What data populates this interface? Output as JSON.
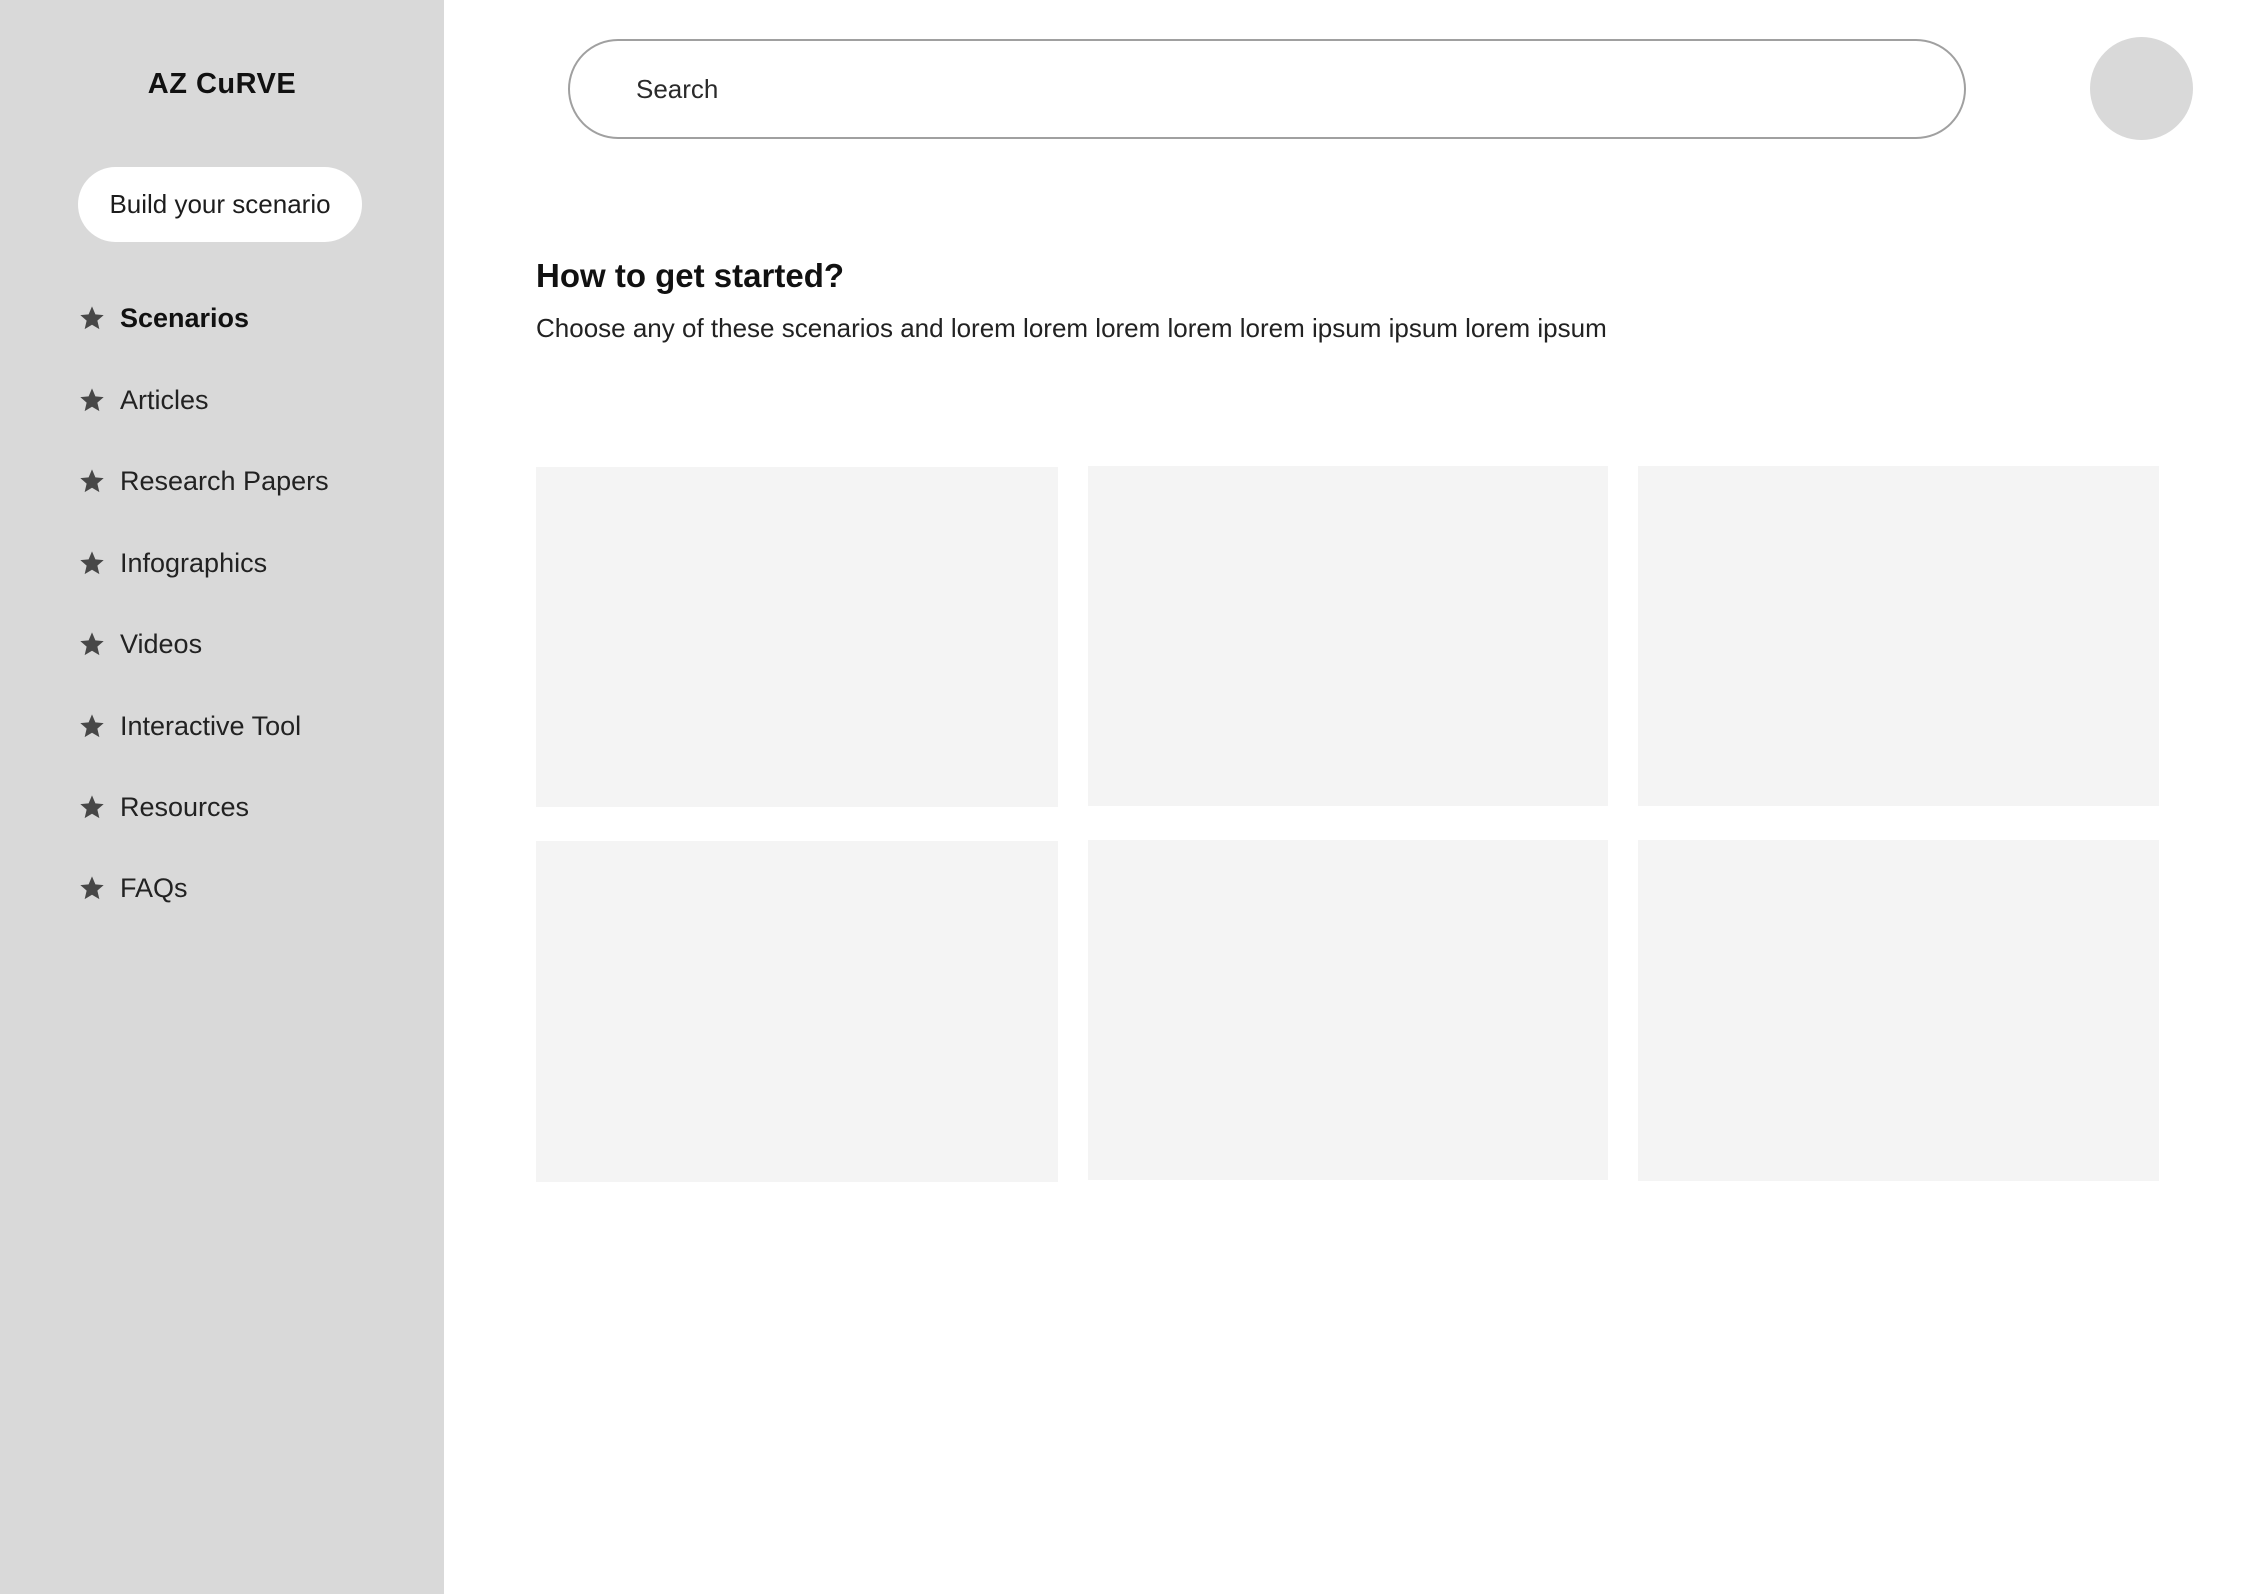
{
  "sidebar": {
    "logo": "AZ CuRVE",
    "build_button": "Build your scenario",
    "items": [
      {
        "label": "Scenarios",
        "icon": "star-icon",
        "active": true
      },
      {
        "label": "Articles",
        "icon": "star-icon",
        "active": false
      },
      {
        "label": "Research Papers",
        "icon": "star-icon",
        "active": false
      },
      {
        "label": "Infographics",
        "icon": "star-icon",
        "active": false
      },
      {
        "label": "Videos",
        "icon": "star-icon",
        "active": false
      },
      {
        "label": "Interactive Tool",
        "icon": "star-icon",
        "active": false
      },
      {
        "label": "Resources",
        "icon": "star-icon",
        "active": false
      },
      {
        "label": "FAQs",
        "icon": "star-icon",
        "active": false
      }
    ]
  },
  "header": {
    "search": {
      "placeholder": "Search",
      "value": ""
    },
    "avatar": "user-avatar"
  },
  "main": {
    "heading": "How to get started?",
    "subtitle": "Choose any of these scenarios and lorem lorem lorem lorem lorem ipsum ipsum lorem ipsum",
    "cards": [
      {
        "name": "scenario-card-1"
      },
      {
        "name": "scenario-card-2"
      },
      {
        "name": "scenario-card-3"
      },
      {
        "name": "scenario-card-4"
      },
      {
        "name": "scenario-card-5"
      },
      {
        "name": "scenario-card-6"
      }
    ]
  },
  "colors": {
    "sidebar_bg": "#d9d9d9",
    "card_bg": "#f4f4f4",
    "avatar_bg": "#d9d9d9",
    "search_border": "#a0a0a0"
  }
}
